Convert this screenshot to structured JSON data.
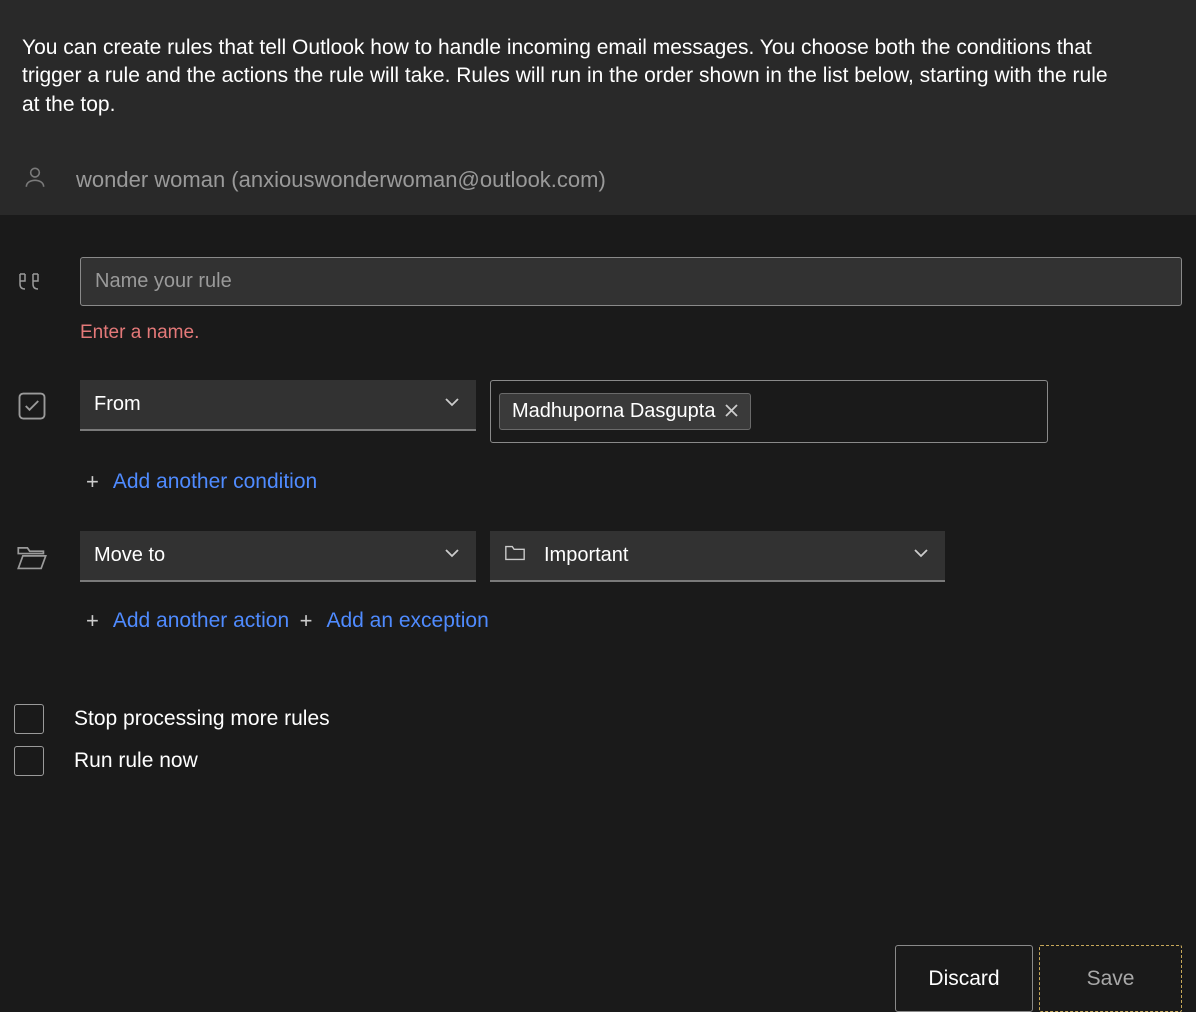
{
  "description": "You can create rules that tell Outlook how to handle incoming email messages. You choose both the conditions that trigger a rule and the actions the rule will take. Rules will run in the order shown in the list below, starting with the rule at the top.",
  "account": "wonder woman (anxiouswonderwoman@outlook.com)",
  "rule_name": {
    "placeholder": "Name your rule",
    "value": "",
    "error": "Enter a name."
  },
  "condition": {
    "type": "From",
    "person": "Madhuporna Dasgupta",
    "add_label": "Add another condition"
  },
  "action": {
    "type": "Move to",
    "folder": "Important",
    "add_action_label": "Add another action",
    "add_exception_label": "Add an exception"
  },
  "checkboxes": {
    "stop_processing": "Stop processing more rules",
    "run_now": "Run rule now"
  },
  "buttons": {
    "discard": "Discard",
    "save": "Save"
  }
}
